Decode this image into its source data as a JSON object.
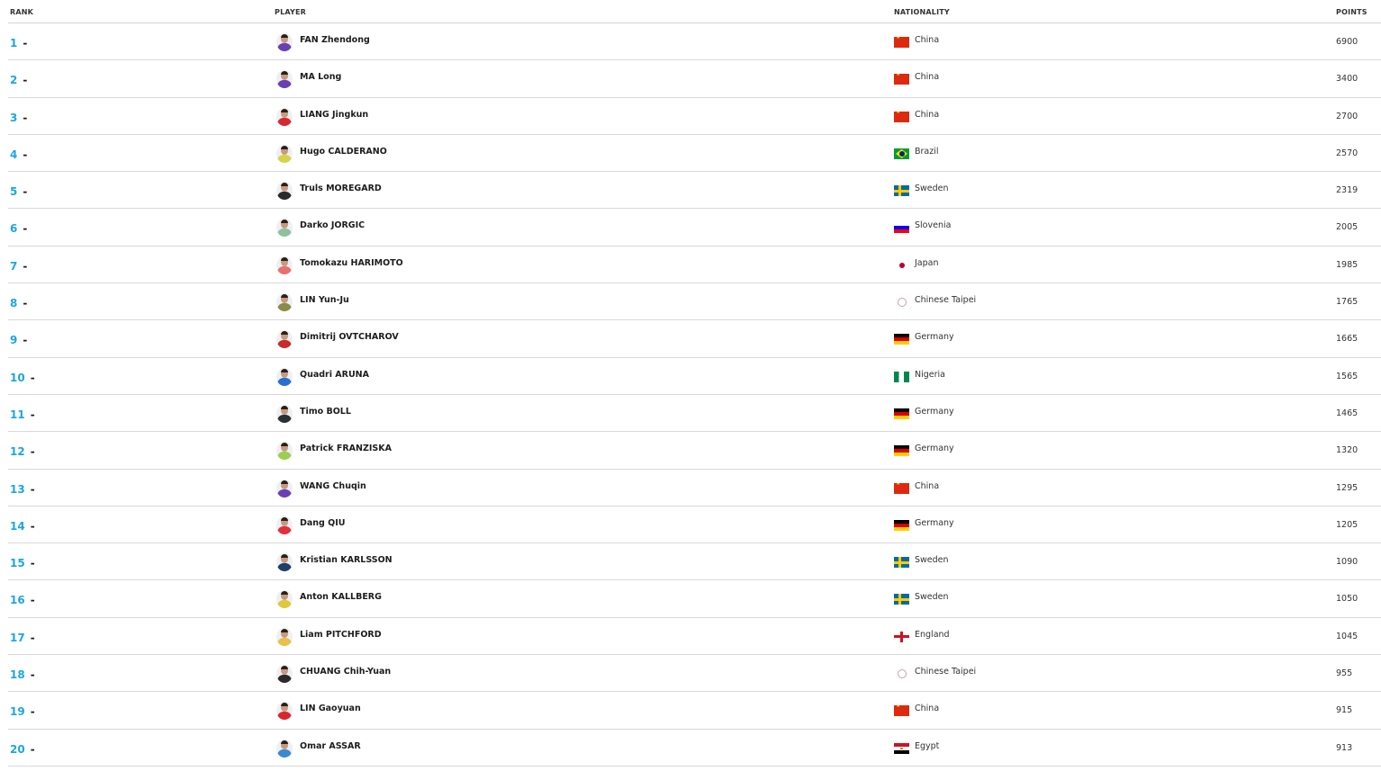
{
  "headers": {
    "rank": "RANK",
    "player": "PLAYER",
    "nationality": "NATIONALITY",
    "points": "POINTS"
  },
  "rows": [
    {
      "rank": "1",
      "dash": "-",
      "player": "FAN Zhendong",
      "nationality": "China",
      "flag": "china",
      "points": "6900",
      "shirt": "#6a3fb5"
    },
    {
      "rank": "2",
      "dash": "-",
      "player": "MA Long",
      "nationality": "China",
      "flag": "china",
      "points": "3400",
      "shirt": "#6a3fb5"
    },
    {
      "rank": "3",
      "dash": "-",
      "player": "LIANG Jingkun",
      "nationality": "China",
      "flag": "china",
      "points": "2700",
      "shirt": "#d8282f"
    },
    {
      "rank": "4",
      "dash": "-",
      "player": "Hugo CALDERANO",
      "nationality": "Brazil",
      "flag": "brazil",
      "points": "2570",
      "shirt": "#d8d24a"
    },
    {
      "rank": "5",
      "dash": "-",
      "player": "Truls MOREGARD",
      "nationality": "Sweden",
      "flag": "sweden",
      "points": "2319",
      "shirt": "#2a2a2a"
    },
    {
      "rank": "6",
      "dash": "-",
      "player": "Darko JORGIC",
      "nationality": "Slovenia",
      "flag": "slovenia",
      "points": "2005",
      "shirt": "#8fc0a0"
    },
    {
      "rank": "7",
      "dash": "-",
      "player": "Tomokazu HARIMOTO",
      "nationality": "Japan",
      "flag": "japan",
      "points": "1985",
      "shirt": "#e8716f"
    },
    {
      "rank": "8",
      "dash": "-",
      "player": "LIN Yun-Ju",
      "nationality": "Chinese Taipei",
      "flag": "taipei",
      "points": "1765",
      "shirt": "#8a8a4a"
    },
    {
      "rank": "9",
      "dash": "-",
      "player": "Dimitrij OVTCHAROV",
      "nationality": "Germany",
      "flag": "germany",
      "points": "1665",
      "shirt": "#c92a2a"
    },
    {
      "rank": "10",
      "dash": "-",
      "player": "Quadri ARUNA",
      "nationality": "Nigeria",
      "flag": "nigeria",
      "points": "1565",
      "shirt": "#2a6fd0"
    },
    {
      "rank": "11",
      "dash": "-",
      "player": "Timo BOLL",
      "nationality": "Germany",
      "flag": "germany",
      "points": "1465",
      "shirt": "#2a2f35"
    },
    {
      "rank": "12",
      "dash": "-",
      "player": "Patrick FRANZISKA",
      "nationality": "Germany",
      "flag": "germany",
      "points": "1320",
      "shirt": "#9bcf52"
    },
    {
      "rank": "13",
      "dash": "-",
      "player": "WANG Chuqin",
      "nationality": "China",
      "flag": "china",
      "points": "1295",
      "shirt": "#6a3fb5"
    },
    {
      "rank": "14",
      "dash": "-",
      "player": "Dang QIU",
      "nationality": "Germany",
      "flag": "germany",
      "points": "1205",
      "shirt": "#e0303a"
    },
    {
      "rank": "15",
      "dash": "-",
      "player": "Kristian KARLSSON",
      "nationality": "Sweden",
      "flag": "sweden",
      "points": "1090",
      "shirt": "#1f3e6a"
    },
    {
      "rank": "16",
      "dash": "-",
      "player": "Anton KALLBERG",
      "nationality": "Sweden",
      "flag": "sweden",
      "points": "1050",
      "shirt": "#e0c83a"
    },
    {
      "rank": "17",
      "dash": "-",
      "player": "Liam PITCHFORD",
      "nationality": "England",
      "flag": "england",
      "points": "1045",
      "shirt": "#e8c04a"
    },
    {
      "rank": "18",
      "dash": "-",
      "player": "CHUANG Chih-Yuan",
      "nationality": "Chinese Taipei",
      "flag": "taipei",
      "points": "955",
      "shirt": "#2a2a2a"
    },
    {
      "rank": "19",
      "dash": "-",
      "player": "LIN Gaoyuan",
      "nationality": "China",
      "flag": "china",
      "points": "915",
      "shirt": "#d8282f"
    },
    {
      "rank": "20",
      "dash": "-",
      "player": "Omar ASSAR",
      "nationality": "Egypt",
      "flag": "egypt",
      "points": "913",
      "shirt": "#3a8ad0"
    }
  ]
}
